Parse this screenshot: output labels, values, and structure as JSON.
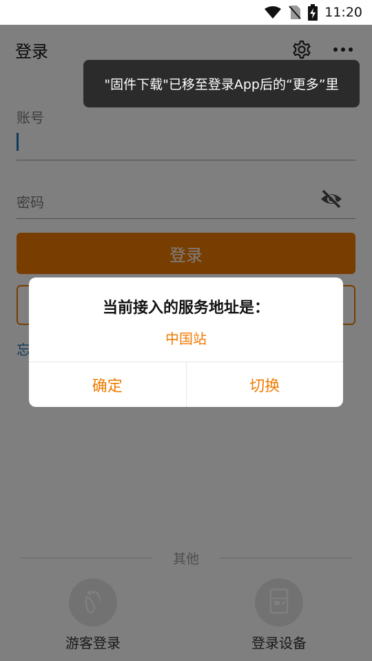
{
  "status_bar": {
    "time": "11:20",
    "icons": [
      "wifi-icon",
      "no-sim-icon",
      "battery-charging-icon"
    ]
  },
  "app_bar": {
    "title": "登录",
    "actions": [
      "settings-icon",
      "more-icon"
    ]
  },
  "toast": {
    "message": "\"固件下载\"已移至登录App后的“更多”里"
  },
  "form": {
    "account_label": "账号",
    "account_value": "",
    "password_label": "密码",
    "password_icon": "eye-off-icon",
    "login_button": "登录",
    "forgot_link": "忘"
  },
  "other": {
    "divider_text": "其他",
    "guest_login_label": "游客登录",
    "guest_login_icon": "footprint-icon",
    "device_login_label": "登录设备",
    "device_login_icon": "device-icon"
  },
  "dialog": {
    "title": "当前接入的服务地址是：",
    "server": "中国站",
    "confirm_button": "确定",
    "switch_button": "切换"
  },
  "colors": {
    "accent": "#f07a00",
    "link": "#1f6fb5",
    "overlay": "rgba(0,0,0,0.5)",
    "toast_bg": "#2b2b2b"
  }
}
